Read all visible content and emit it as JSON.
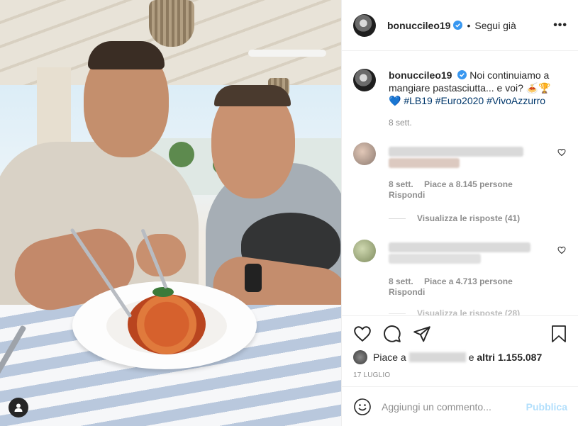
{
  "post": {
    "username": "bonucci​leo19",
    "follow_status": "Segui già",
    "more_label": "•••"
  },
  "caption": {
    "username": "bonuccileo19",
    "text": "Noi continuiamo a mangiare pastasciutta... e voi? 🍝🏆",
    "heart": "💙",
    "hashtags": "#LB19 #Euro2020 #VivoAzzurro",
    "time": "8 sett."
  },
  "comments": [
    {
      "time": "8 sett.",
      "likes": "Piace a 8.145 persone",
      "reply": "Rispondi",
      "view_replies": "Visualizza le risposte (41)"
    },
    {
      "time": "8 sett.",
      "likes": "Piace a 4.713 persone",
      "reply": "Rispondi",
      "view_replies": "Visualizza le risposte (28)"
    }
  ],
  "likes": {
    "prefix": "Piace a",
    "suffix": "e",
    "count": "altri 1.155.087"
  },
  "date": "17 LUGLIO",
  "composer": {
    "placeholder": "Aggiungi un commento...",
    "publish": "Pubblica"
  },
  "colors": {
    "verified": "#3897f0",
    "hashtag": "#00376b",
    "publish_disabled": "#b2dffc",
    "meta_gray": "#8e8e8e"
  }
}
